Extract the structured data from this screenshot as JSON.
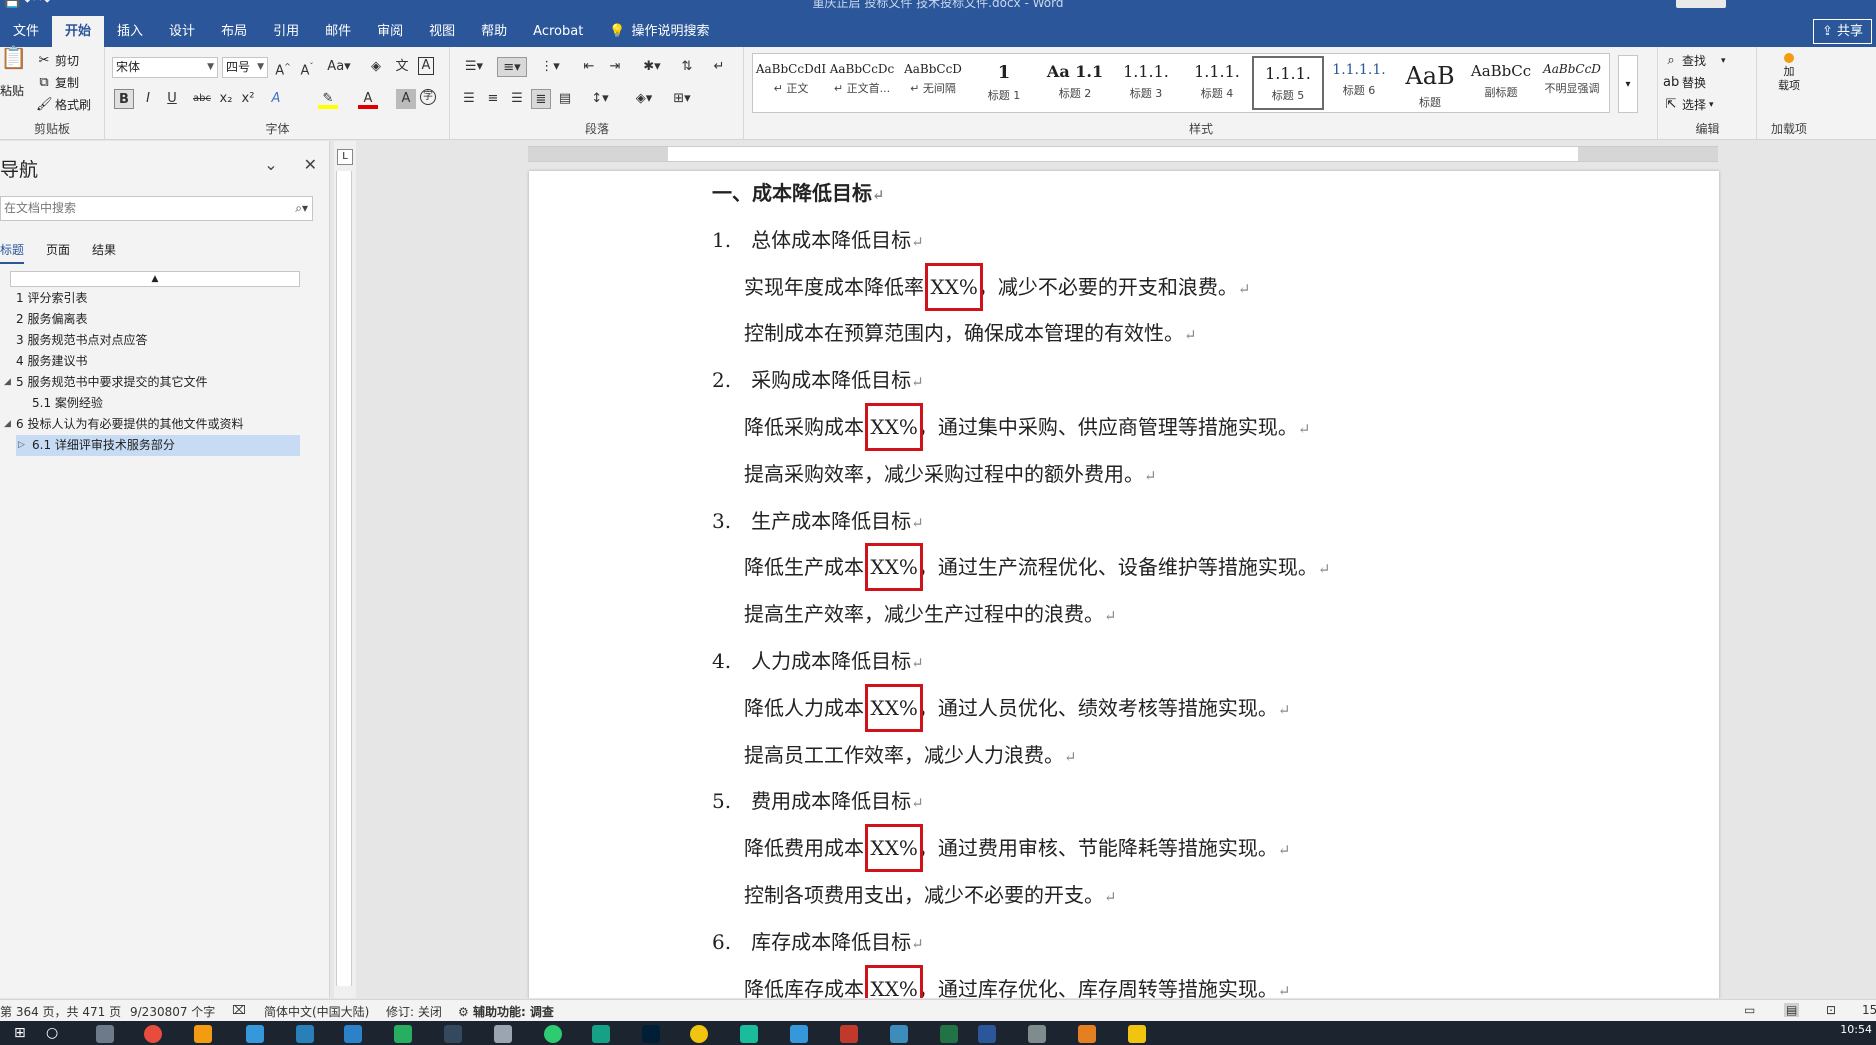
{
  "window": {
    "doc_title": "重庆正启 投标文件 技术投标文件.docx - Word",
    "share_label": "共享"
  },
  "tabs": [
    "文件",
    "开始",
    "插入",
    "设计",
    "布局",
    "引用",
    "邮件",
    "审阅",
    "视图",
    "帮助",
    "Acrobat"
  ],
  "tell_me": "操作说明搜索",
  "ribbon": {
    "clipboard": {
      "paste": "粘贴",
      "cut": "剪切",
      "copy": "复制",
      "format_painter": "格式刷",
      "label": "剪贴板"
    },
    "font": {
      "font_name": "宋体",
      "font_size": "四号",
      "label": "字体",
      "buttons": [
        "B",
        "I",
        "U",
        "abc",
        "x₂",
        "x²"
      ]
    },
    "paragraph": {
      "label": "段落"
    },
    "styles": {
      "label": "样式",
      "items": [
        {
          "sample": "AaBbCcDdI",
          "name": "↵ 正文"
        },
        {
          "sample": "AaBbCcDc",
          "name": "↵ 正文首..."
        },
        {
          "sample": "AaBbCcD",
          "name": "↵ 无间隔"
        },
        {
          "sample": "1",
          "name": "标题 1"
        },
        {
          "sample": "Aa 1.1",
          "name": "标题 2"
        },
        {
          "sample": "1.1.1.",
          "name": "标题 3"
        },
        {
          "sample": "1.1.1.",
          "name": "标题 4"
        },
        {
          "sample": "1.1.1.",
          "name": "标题 5"
        },
        {
          "sample": "1.1.1.1.",
          "name": "标题 6"
        },
        {
          "sample": "AaB",
          "name": "标题"
        },
        {
          "sample": "AaBbCc",
          "name": "副标题"
        },
        {
          "sample": "AaBbCcD",
          "name": "不明显强调"
        }
      ],
      "selected_index": 7
    },
    "editing": {
      "find": "查找",
      "replace": "替换",
      "select": "选择",
      "label": "编辑"
    },
    "addins": {
      "addin_label": "加\n载项",
      "label": "加载项"
    }
  },
  "nav": {
    "title": "导航",
    "search_placeholder": "在文档中搜索",
    "tabs": [
      "标题",
      "页面",
      "结果"
    ],
    "items": [
      {
        "text": "1 评分索引表",
        "level": 1,
        "tri": ""
      },
      {
        "text": "2 服务偏离表",
        "level": 1,
        "tri": ""
      },
      {
        "text": "3 服务规范书点对点应答",
        "level": 1,
        "tri": ""
      },
      {
        "text": "4 服务建议书",
        "level": 1,
        "tri": ""
      },
      {
        "text": "5 服务规范书中要求提交的其它文件",
        "level": 1,
        "tri": "◢"
      },
      {
        "text": "5.1 案例经验",
        "level": 2,
        "tri": ""
      },
      {
        "text": "6 投标人认为有必要提供的其他文件或资料",
        "level": 1,
        "tri": "◢"
      },
      {
        "text": "6.1 详细评审技术服务部分",
        "level": 2,
        "tri": "▷",
        "selected": true
      }
    ]
  },
  "document": {
    "lines": [
      {
        "text": "一、成本降低目标",
        "mark": "↵",
        "heading": true
      },
      {
        "text": "1. 总体成本降低目标",
        "mark": "↵"
      },
      {
        "text": "实现年度成本降低率 XX%，减少不必要的开支和浪费。",
        "mark": "↵"
      },
      {
        "text": "控制成本在预算范围内，确保成本管理的有效性。",
        "mark": "↵"
      },
      {
        "text": "2. 采购成本降低目标",
        "mark": "↵"
      },
      {
        "text": "降低采购成本 XX%，通过集中采购、供应商管理等措施实现。",
        "mark": "↵"
      },
      {
        "text": "提高采购效率，减少采购过程中的额外费用。",
        "mark": "↵"
      },
      {
        "text": "3. 生产成本降低目标",
        "mark": "↵"
      },
      {
        "text": "降低生产成本 XX%，通过生产流程优化、设备维护等措施实现。",
        "mark": "↵"
      },
      {
        "text": "提高生产效率，减少生产过程中的浪费。",
        "mark": "↵"
      },
      {
        "text": "4. 人力成本降低目标",
        "mark": "↵"
      },
      {
        "text": "降低人力成本 XX%，通过人员优化、绩效考核等措施实现。",
        "mark": "↵"
      },
      {
        "text": "提高员工工作效率，减少人力浪费。",
        "mark": "↵"
      },
      {
        "text": "5. 费用成本降低目标",
        "mark": "↵"
      },
      {
        "text": "降低费用成本 XX%，通过费用审核、节能降耗等措施实现。",
        "mark": "↵"
      },
      {
        "text": "控制各项费用支出，减少不必要的开支。",
        "mark": "↵"
      },
      {
        "text": "6. 库存成本降低目标",
        "mark": "↵"
      },
      {
        "text": "降低库存成本 XX%，通过库存优化、库存周转等措施实现。",
        "mark": "↵"
      }
    ],
    "highlight_color": "#d0121b"
  },
  "status": {
    "page": "第 364 页，共 471 页",
    "words": "9/230807 个字",
    "language": "简体中文(中国大陆)",
    "track": "修订: 关闭",
    "accessibility": "辅助功能: 调查",
    "zoom": "15"
  },
  "clock": "10:54",
  "colors": {
    "accent": "#2b579a",
    "highlight": "#d0121b",
    "nav_selected": "#c7dcf4"
  }
}
